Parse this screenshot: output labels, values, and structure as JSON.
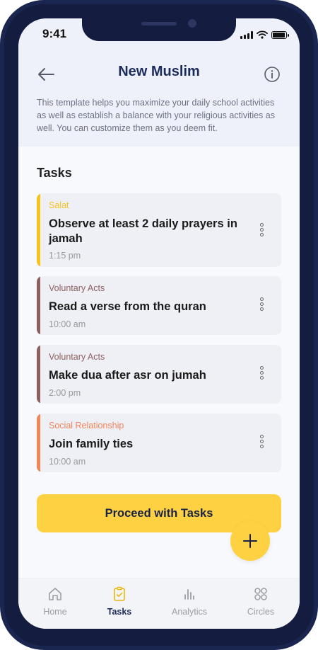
{
  "status_bar": {
    "time": "9:41"
  },
  "header": {
    "title": "New Muslim",
    "description": "This template helps you maximize your daily school activities as well as establish a balance with your religious activities as well. You can customize them as you deem fit."
  },
  "tasks_section": {
    "title": "Tasks",
    "items": [
      {
        "category": "Salat",
        "title": "Observe at least 2 daily prayers in jamah",
        "time": "1:15 pm",
        "accent": "#f6c21c"
      },
      {
        "category": "Voluntary Acts",
        "title": "Read a verse from the quran",
        "time": "10:00 am",
        "accent": "#8f5f5f"
      },
      {
        "category": "Voluntary Acts",
        "title": "Make dua after asr on jumah",
        "time": "2:00 pm",
        "accent": "#8f5f5f"
      },
      {
        "category": "Social Relationship",
        "title": "Join family ties",
        "time": "10:00 am",
        "accent": "#f4845a"
      }
    ]
  },
  "actions": {
    "proceed_label": "Proceed with Tasks"
  },
  "bottom_nav": {
    "items": [
      {
        "label": "Home"
      },
      {
        "label": "Tasks"
      },
      {
        "label": "Analytics"
      },
      {
        "label": "Circles"
      }
    ],
    "active": "Tasks"
  },
  "colors": {
    "brand_navy": "#1d2b5a",
    "accent_yellow": "#fdd141",
    "salat": "#f6c21c",
    "voluntary": "#8f5f5f",
    "social": "#f4845a"
  }
}
